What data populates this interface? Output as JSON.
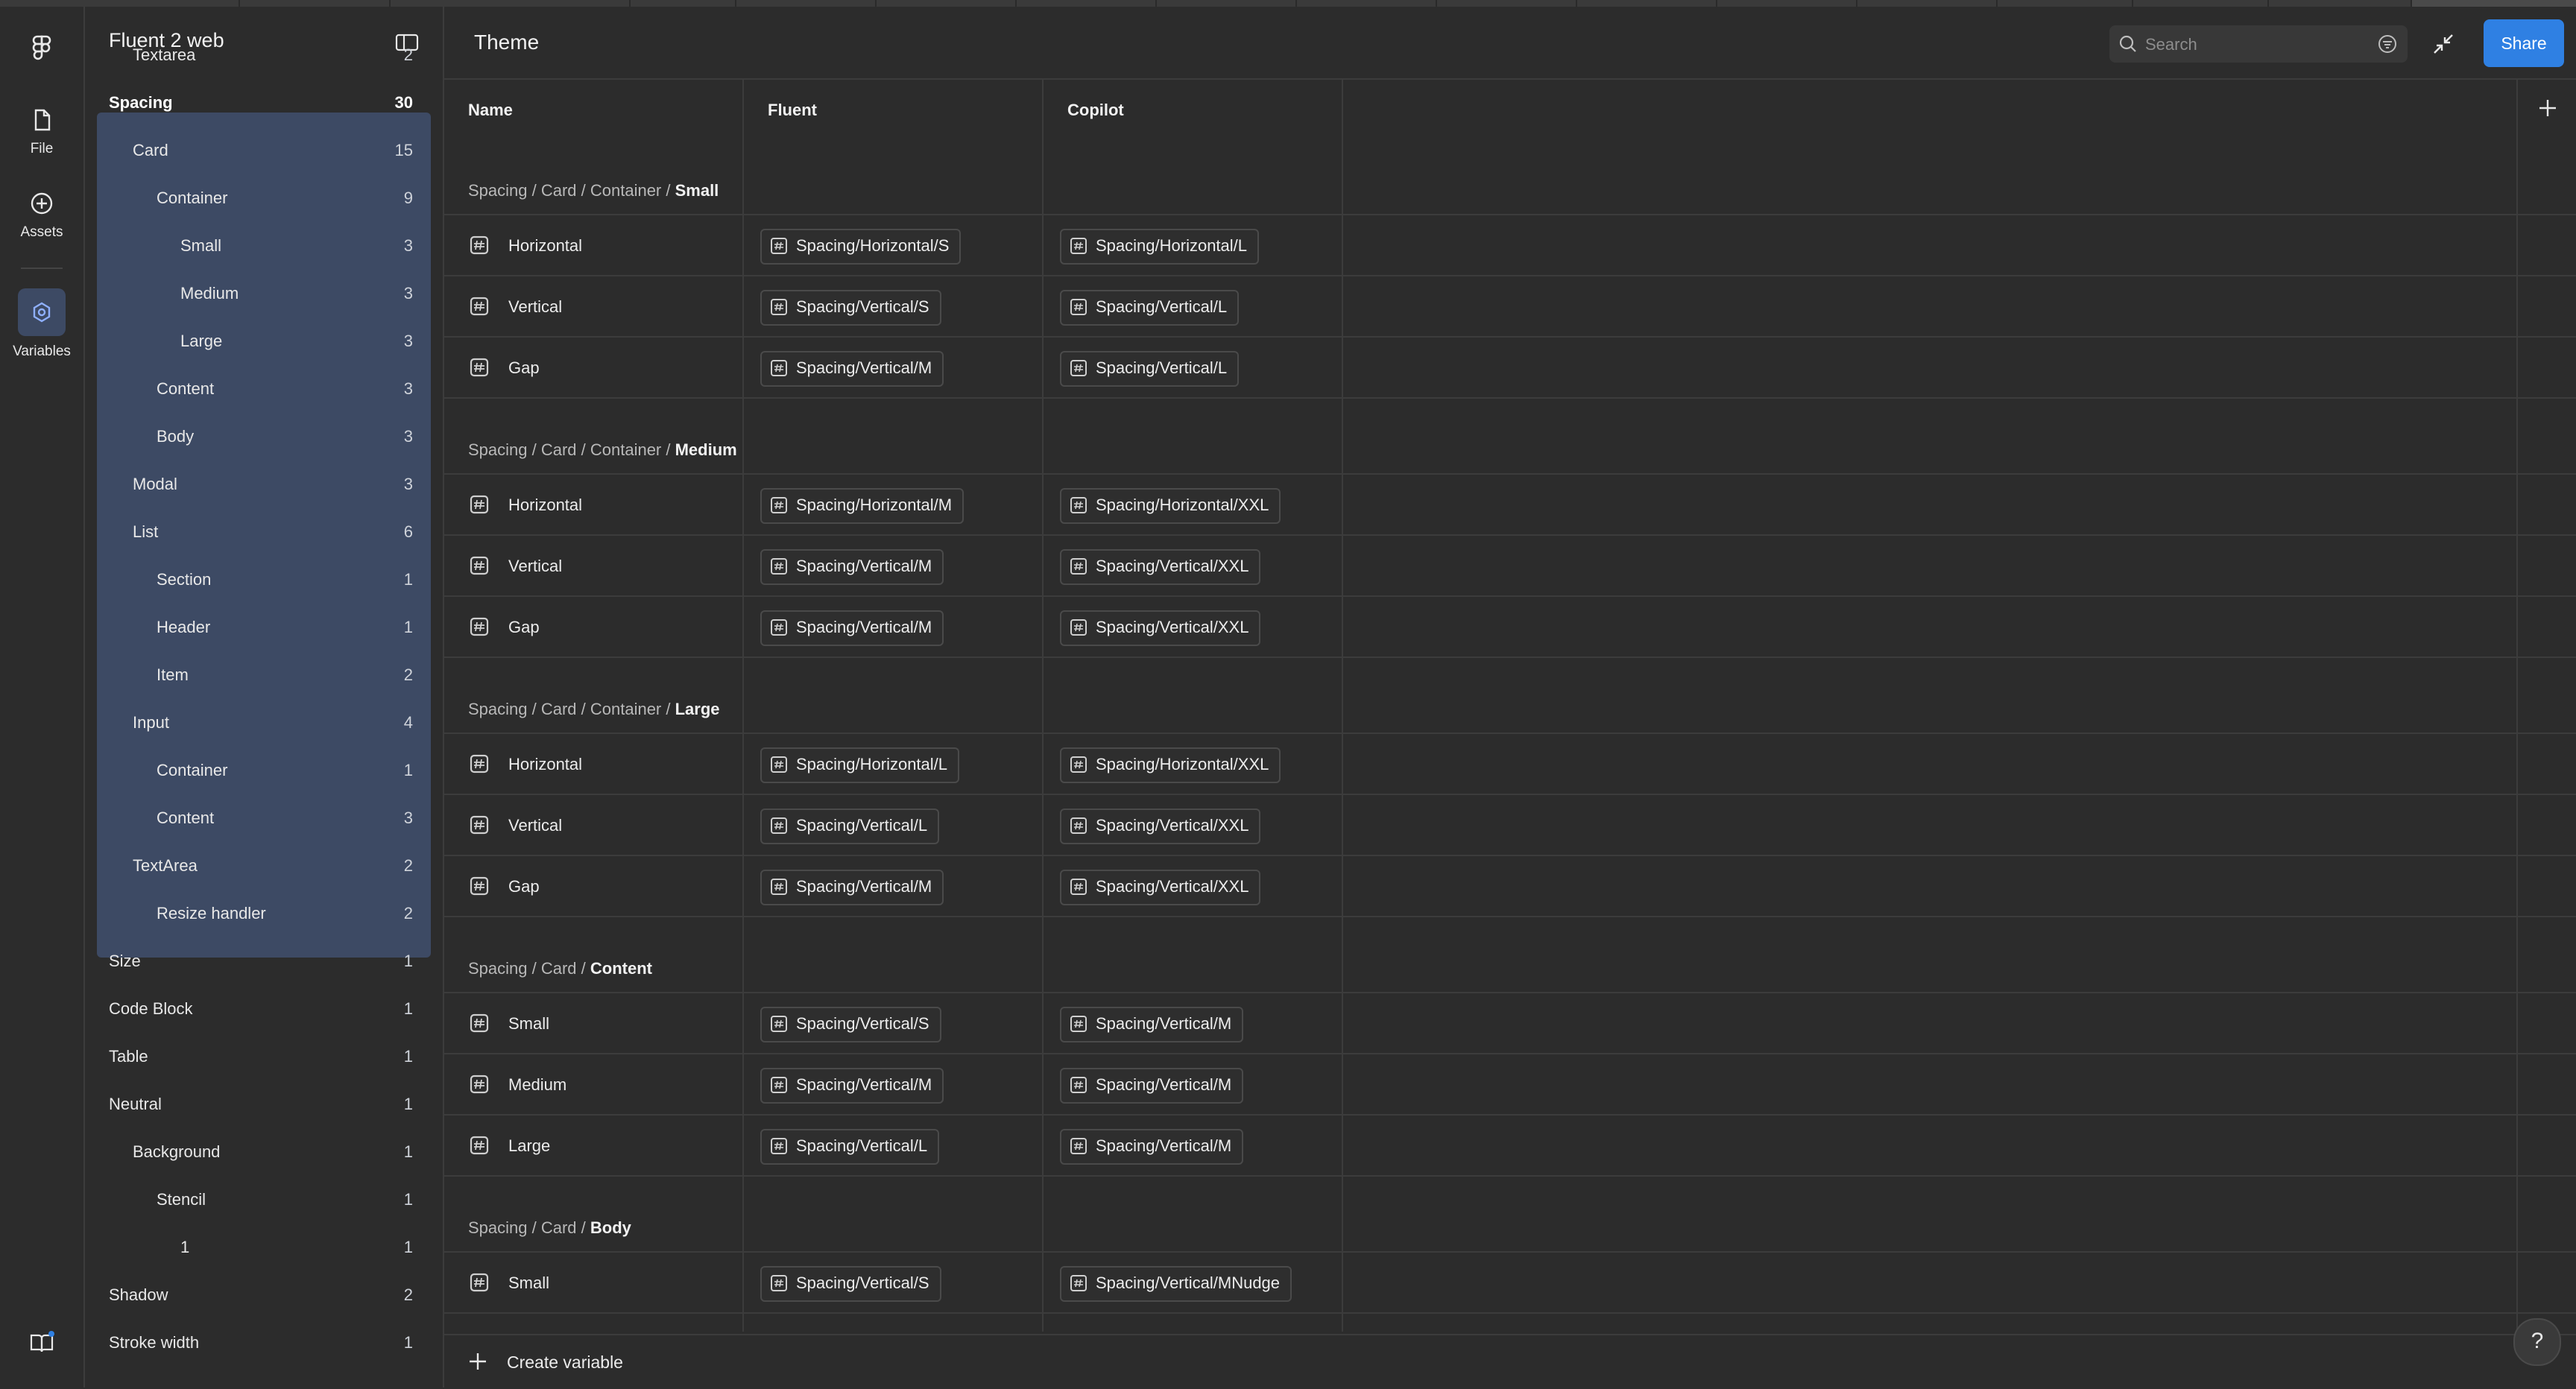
{
  "rail": {
    "items": [
      {
        "label": "File",
        "icon": "file-icon"
      },
      {
        "label": "Assets",
        "icon": "plus-circle-icon"
      },
      {
        "label": "Variables",
        "icon": "variables-icon"
      }
    ]
  },
  "sidebar": {
    "title": "Fluent 2 web",
    "items": [
      {
        "label": "Textarea",
        "count": "2",
        "indent": 1
      },
      {
        "label": "Spacing",
        "count": "30",
        "indent": 0,
        "selected": true
      },
      {
        "label": "Card",
        "count": "15",
        "indent": 1
      },
      {
        "label": "Container",
        "count": "9",
        "indent": 2
      },
      {
        "label": "Small",
        "count": "3",
        "indent": 3
      },
      {
        "label": "Medium",
        "count": "3",
        "indent": 3
      },
      {
        "label": "Large",
        "count": "3",
        "indent": 3
      },
      {
        "label": "Content",
        "count": "3",
        "indent": 2
      },
      {
        "label": "Body",
        "count": "3",
        "indent": 2
      },
      {
        "label": "Modal",
        "count": "3",
        "indent": 1
      },
      {
        "label": "List",
        "count": "6",
        "indent": 1
      },
      {
        "label": "Section",
        "count": "1",
        "indent": 2
      },
      {
        "label": "Header",
        "count": "1",
        "indent": 2
      },
      {
        "label": "Item",
        "count": "2",
        "indent": 2
      },
      {
        "label": "Input",
        "count": "4",
        "indent": 1
      },
      {
        "label": "Container",
        "count": "1",
        "indent": 2
      },
      {
        "label": "Content",
        "count": "3",
        "indent": 2
      },
      {
        "label": "TextArea",
        "count": "2",
        "indent": 1
      },
      {
        "label": "Resize handler",
        "count": "2",
        "indent": 2
      },
      {
        "label": "Size",
        "count": "1",
        "indent": 0
      },
      {
        "label": "Code Block",
        "count": "1",
        "indent": 0
      },
      {
        "label": "Table",
        "count": "1",
        "indent": 0
      },
      {
        "label": "Neutral",
        "count": "1",
        "indent": 0
      },
      {
        "label": "Background",
        "count": "1",
        "indent": 1
      },
      {
        "label": "Stencil",
        "count": "1",
        "indent": 2
      },
      {
        "label": "1",
        "count": "1",
        "indent": 3
      },
      {
        "label": "Shadow",
        "count": "2",
        "indent": 0
      },
      {
        "label": "Stroke width",
        "count": "1",
        "indent": 0
      }
    ]
  },
  "main": {
    "title": "Theme",
    "search_placeholder": "Search",
    "share_label": "Share",
    "columns": [
      "Name",
      "Fluent",
      "Copilot"
    ],
    "groups": [
      {
        "path": "Spacing / Card / Container / ",
        "leaf": "Small",
        "rows": [
          {
            "name": "Horizontal",
            "fluent": "Spacing/Horizontal/S",
            "copilot": "Spacing/Horizontal/L"
          },
          {
            "name": "Vertical",
            "fluent": "Spacing/Vertical/S",
            "copilot": "Spacing/Vertical/L"
          },
          {
            "name": "Gap",
            "fluent": "Spacing/Vertical/M",
            "copilot": "Spacing/Vertical/L"
          }
        ]
      },
      {
        "path": "Spacing / Card / Container / ",
        "leaf": "Medium",
        "rows": [
          {
            "name": "Horizontal",
            "fluent": "Spacing/Horizontal/M",
            "copilot": "Spacing/Horizontal/XXL"
          },
          {
            "name": "Vertical",
            "fluent": "Spacing/Vertical/M",
            "copilot": "Spacing/Vertical/XXL"
          },
          {
            "name": "Gap",
            "fluent": "Spacing/Vertical/M",
            "copilot": "Spacing/Vertical/XXL"
          }
        ]
      },
      {
        "path": "Spacing / Card / Container / ",
        "leaf": "Large",
        "rows": [
          {
            "name": "Horizontal",
            "fluent": "Spacing/Horizontal/L",
            "copilot": "Spacing/Horizontal/XXL"
          },
          {
            "name": "Vertical",
            "fluent": "Spacing/Vertical/L",
            "copilot": "Spacing/Vertical/XXL"
          },
          {
            "name": "Gap",
            "fluent": "Spacing/Vertical/M",
            "copilot": "Spacing/Vertical/XXL"
          }
        ]
      },
      {
        "path": "Spacing / Card / ",
        "leaf": "Content",
        "rows": [
          {
            "name": "Small",
            "fluent": "Spacing/Vertical/S",
            "copilot": "Spacing/Vertical/M"
          },
          {
            "name": "Medium",
            "fluent": "Spacing/Vertical/M",
            "copilot": "Spacing/Vertical/M"
          },
          {
            "name": "Large",
            "fluent": "Spacing/Vertical/L",
            "copilot": "Spacing/Vertical/M"
          }
        ]
      },
      {
        "path": "Spacing / Card / ",
        "leaf": "Body",
        "rows": [
          {
            "name": "Small",
            "fluent": "Spacing/Vertical/S",
            "copilot": "Spacing/Vertical/MNudge"
          }
        ]
      }
    ],
    "create_label": "Create variable",
    "help_label": "?"
  },
  "colors": {
    "background": "#2c2c2c",
    "selection": "#3d4a64",
    "accent": "#2f80e3",
    "border": "#3c3c3c"
  }
}
